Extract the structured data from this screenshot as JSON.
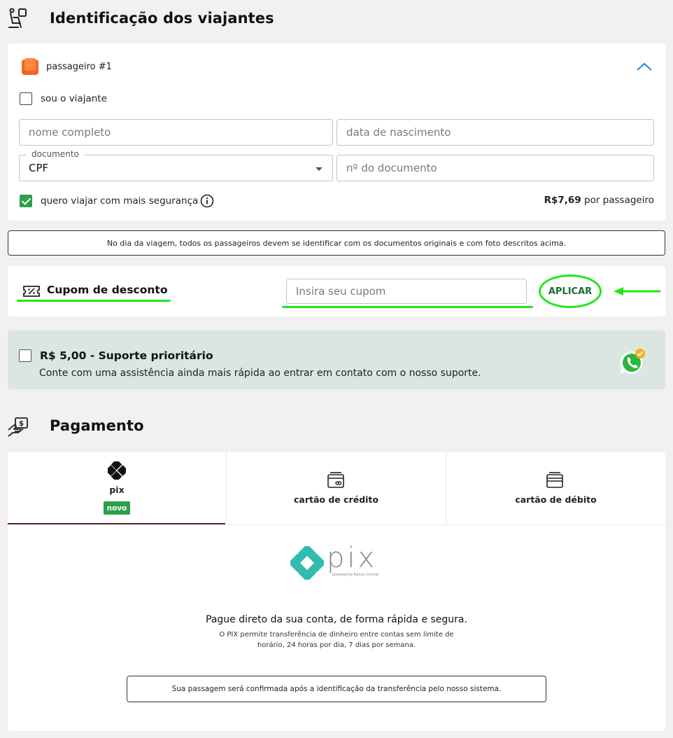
{
  "travelers_section": {
    "title": "Identificação dos viajantes",
    "icon": "traveler-seat-icon"
  },
  "passenger": {
    "label": "passageiro #1",
    "icon": "seat-icon",
    "collapse_icon": "chevron-up-icon",
    "self_traveler_label": "sou o viajante",
    "self_traveler_checked": false,
    "full_name_placeholder": "nome completo",
    "birth_date_placeholder": "data de nascimento",
    "document_legend": "documento",
    "document_value": "CPF",
    "document_number_placeholder": "nº do documento",
    "insurance_label": "quero viajar com mais segurança",
    "insurance_checked": true,
    "insurance_price": "R$7,69",
    "insurance_suffix": "por passageiro"
  },
  "notice": "No dia da viagem, todos os passageiros devem se identificar com os documentos originais e com foto descritos acima.",
  "coupon": {
    "title": "Cupom de desconto",
    "icon": "ticket-percent-icon",
    "placeholder": "Insira seu cupom",
    "apply_label": "APLICAR"
  },
  "support": {
    "title": "R$ 5,00 - Suporte prioritário",
    "description": "Conte com uma assistência ainda mais rápida ao entrar em contato com o nosso suporte.",
    "checked": false,
    "icon": "whatsapp-icon"
  },
  "payment_section": {
    "title": "Pagamento",
    "icon": "payment-hand-icon"
  },
  "payment_tabs": [
    {
      "label": "pix",
      "badge": "novo",
      "icon": "pix-icon",
      "active": true
    },
    {
      "label": "cartão de crédito",
      "icon": "credit-card-icon",
      "active": false
    },
    {
      "label": "cartão de débito",
      "icon": "debit-card-icon",
      "active": false
    }
  ],
  "pix": {
    "logo_text": "pix",
    "logo_tagline": "powered by Banco Central",
    "headline": "Pague direto da sua conta, de forma rápida e segura.",
    "description": "O PIX permite transferência de dinheiro entre contas sem limite de horário, 24 horas por dia, 7 dias por semana.",
    "confirmation": "Sua passagem será confirmada após a identificação da transferência pelo nosso sistema."
  },
  "colors": {
    "accent_green": "#2e9e49",
    "highlight_green": "#22e61a",
    "active_tab": "#5a1a2c",
    "pix_teal": "#32bcad",
    "support_bg": "#dbe6e1"
  }
}
